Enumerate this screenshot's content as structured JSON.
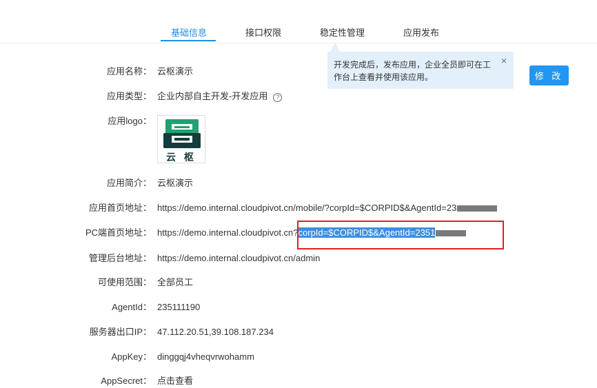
{
  "tabs": [
    {
      "label": "基础信息",
      "active": true
    },
    {
      "label": "接口权限",
      "active": false
    },
    {
      "label": "稳定性管理",
      "active": false
    },
    {
      "label": "应用发布",
      "active": false
    }
  ],
  "tooltip": {
    "text": "开发完成后，发布应用，企业全员即可在工作台上查看并使用该应用。",
    "close_icon": "×"
  },
  "edit_button": "修 改",
  "fields": {
    "app_name": {
      "label": "应用名称：",
      "value": "云枢演示"
    },
    "app_type": {
      "label": "应用类型：",
      "value": "企业内部自主开发-开发应用"
    },
    "app_logo": {
      "label": "应用logo：",
      "logo_text": "云 枢"
    },
    "app_desc": {
      "label": "应用简介：",
      "value": "云枢演示"
    },
    "home_url": {
      "label": "应用首页地址：",
      "value": "https://demo.internal.cloudpivot.cn/mobile/?corpId=$CORPID$&AgentId=23"
    },
    "pc_url": {
      "label": "PC端首页地址：",
      "prefix": "https://demo.internal.cloudpivot.cn?",
      "highlight": "corpId=$CORPID$&AgentId=2351"
    },
    "admin_url": {
      "label": "管理后台地址：",
      "value": "https://demo.internal.cloudpivot.cn/admin"
    },
    "scope": {
      "label": "可使用范围：",
      "value": "全部员工"
    },
    "agent_id": {
      "label": "AgentId：",
      "value": "235111190"
    },
    "server_ip": {
      "label": "服务器出口IP：",
      "value": "47.112.20.51,39.108.187.234"
    },
    "app_key": {
      "label": "AppKey：",
      "value": "dinggqj4vheqvrwohamm"
    },
    "app_secret": {
      "label": "AppSecret：",
      "value": "点击查看"
    }
  },
  "colors": {
    "accent": "#1e8ce6",
    "button": "#2196f3",
    "tooltip_bg": "#e3f0fb",
    "annotation_red": "#e02020"
  }
}
